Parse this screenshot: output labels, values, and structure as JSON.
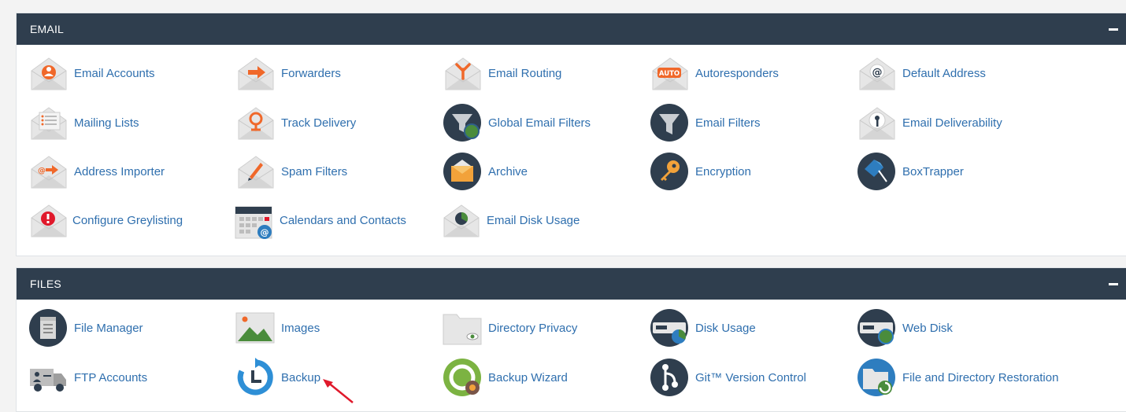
{
  "sections": {
    "email": {
      "title": "EMAIL",
      "items": [
        {
          "label": "Email Accounts"
        },
        {
          "label": "Forwarders"
        },
        {
          "label": "Email Routing"
        },
        {
          "label": "Autoresponders",
          "badge": "AUTO"
        },
        {
          "label": "Default Address",
          "badge": "@"
        },
        {
          "label": "Mailing Lists"
        },
        {
          "label": "Track Delivery"
        },
        {
          "label": "Global Email Filters"
        },
        {
          "label": "Email Filters"
        },
        {
          "label": "Email Deliverability"
        },
        {
          "label": "Address Importer",
          "badge": "@"
        },
        {
          "label": "Spam Filters"
        },
        {
          "label": "Archive"
        },
        {
          "label": "Encryption"
        },
        {
          "label": "BoxTrapper"
        },
        {
          "label": "Configure Greylisting"
        },
        {
          "label": "Calendars and Contacts",
          "badge": "@"
        },
        {
          "label": "Email Disk Usage"
        }
      ]
    },
    "files": {
      "title": "FILES",
      "items": [
        {
          "label": "File Manager"
        },
        {
          "label": "Images"
        },
        {
          "label": "Directory Privacy"
        },
        {
          "label": "Disk Usage"
        },
        {
          "label": "Web Disk"
        },
        {
          "label": "FTP Accounts"
        },
        {
          "label": "Backup"
        },
        {
          "label": "Backup Wizard"
        },
        {
          "label": "Git™ Version Control"
        },
        {
          "label": "File and Directory Restoration"
        }
      ]
    }
  },
  "colors": {
    "header_bg": "#2f3e4e",
    "link": "#2f6fae",
    "accent_orange": "#f0682a",
    "icon_dark": "#2f3e4e",
    "arrow": "#e0192b"
  }
}
